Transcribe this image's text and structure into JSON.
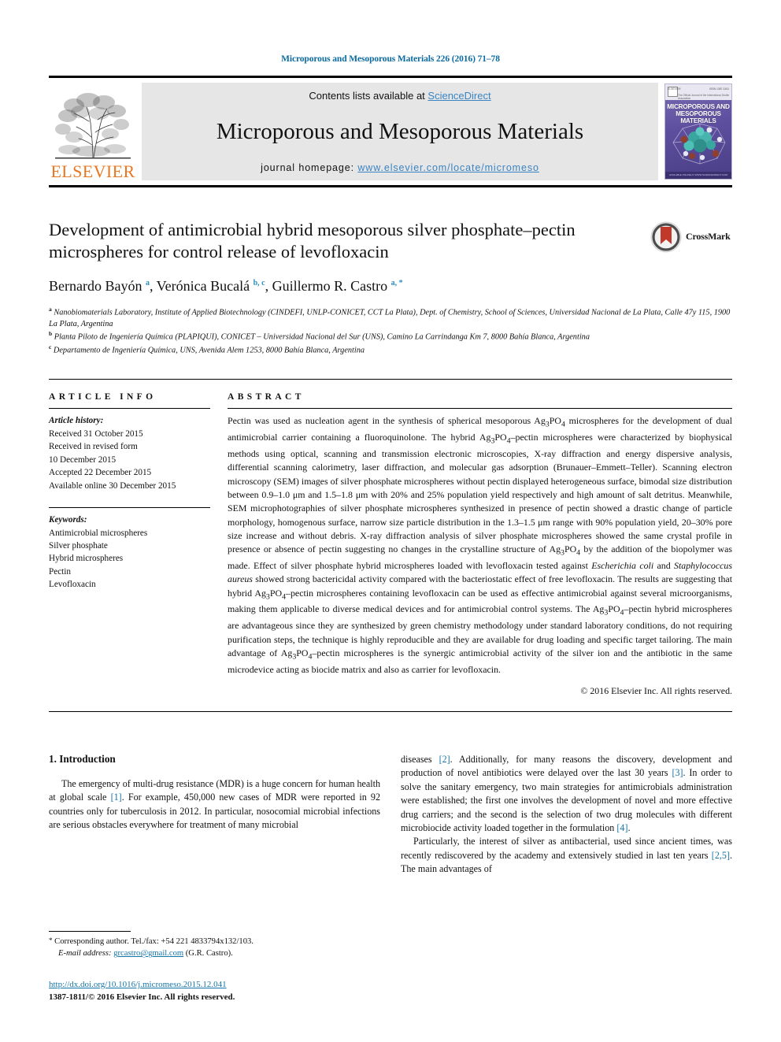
{
  "running_head": "Microporous and Mesoporous Materials 226 (2016) 71–78",
  "masthead": {
    "publisher_name": "ELSEVIER",
    "contents_prefix": "Contents lists available at ",
    "contents_link": "ScienceDirect",
    "journal_name": "Microporous and Mesoporous Materials",
    "homepage_prefix": "journal homepage: ",
    "homepage_url": "www.elsevier.com/locate/micromeso",
    "cover_title": "MICROPOROUS AND MESOPOROUS MATERIALS",
    "cover_top_left": "ELSEVIER",
    "cover_top_right": "ISSN 1387-1811",
    "cover_subtitle": "The Official Journal of the International Zeolite Association",
    "cover_bottom": "AVAILABLE ONLINE AT WWW.SCIENCEDIRECT.COM"
  },
  "article": {
    "title": "Development of antimicrobial hybrid mesoporous silver phosphate–pectin microspheres for control release of levofloxacin",
    "crossmark_label": "CrossMark",
    "authors_html": "Bernardo Bayón <sup>a</sup>, Verónica Bucalá <sup>b, c</sup>, Guillermo R. Castro <sup>a, *</sup>",
    "affiliations": [
      "Nanobiomaterials Laboratory, Institute of Applied Biotechnology (CINDEFI, UNLP-CONICET, CCT La Plata), Dept. of Chemistry, School of Sciences, Universidad Nacional de La Plata, Calle 47y 115, 1900 La Plata, Argentina",
      "Planta Piloto de Ingeniería Química (PLAPIQUI), CONICET – Universidad Nacional del Sur (UNS), Camino La Carrindanga Km 7, 8000 Bahía Blanca, Argentina",
      "Departamento de Ingeniería Química, UNS, Avenida Alem 1253, 8000 Bahía Blanca, Argentina"
    ],
    "affiliation_marks": [
      "a",
      "b",
      "c"
    ]
  },
  "article_info": {
    "heading": "ARTICLE INFO",
    "history_label": "Article history:",
    "history": [
      "Received 31 October 2015",
      "Received in revised form",
      "10 December 2015",
      "Accepted 22 December 2015",
      "Available online 30 December 2015"
    ],
    "keywords_label": "Keywords:",
    "keywords": [
      "Antimicrobial microspheres",
      "Silver phosphate",
      "Hybrid microspheres",
      "Pectin",
      "Levofloxacin"
    ]
  },
  "abstract": {
    "heading": "ABSTRACT",
    "text_html": "Pectin was used as nucleation agent in the synthesis of spherical mesoporous Ag<sub>3</sub>PO<sub>4</sub> microspheres for the development of dual antimicrobial carrier containing a fluoroquinolone. The hybrid Ag<sub>3</sub>PO<sub>4</sub>–pectin microspheres were characterized by biophysical methods using optical, scanning and transmission electronic microscopies, X-ray diffraction and energy dispersive analysis, differential scanning calorimetry, laser diffraction, and molecular gas adsorption (Brunauer–Emmett–Teller). Scanning electron microscopy (SEM) images of silver phosphate microspheres without pectin displayed heterogeneous surface, bimodal size distribution between 0.9–1.0 μm and 1.5–1.8 μm with 20% and 25% population yield respectively and high amount of salt detritus. Meanwhile, SEM microphotographies of silver phosphate microspheres synthesized in presence of pectin showed a drastic change of particle morphology, homogenous surface, narrow size particle distribution in the 1.3–1.5 μm range with 90% population yield, 20–30% pore size increase and without debris. X-ray diffraction analysis of silver phosphate microspheres showed the same crystal profile in presence or absence of pectin suggesting no changes in the crystalline structure of Ag<sub>3</sub>PO<sub>4</sub> by the addition of the biopolymer was made. Effect of silver phosphate hybrid microspheres loaded with levofloxacin tested against <i>Escherichia coli</i> and <i>Staphylococcus aureus</i> showed strong bactericidal activity compared with the bacteriostatic effect of free levofloxacin. The results are suggesting that hybrid Ag<sub>3</sub>PO<sub>4</sub>–pectin microspheres containing levofloxacin can be used as effective antimicrobial against several microorganisms, making them applicable to diverse medical devices and for antimicrobial control systems. The Ag<sub>3</sub>PO<sub>4</sub>–pectin hybrid microspheres are advantageous since they are synthesized by green chemistry methodology under standard laboratory conditions, do not requiring purification steps, the technique is highly reproducible and they are available for drug loading and specific target tailoring. The main advantage of Ag<sub>3</sub>PO<sub>4</sub>–pectin microspheres is the synergic antimicrobial activity of the silver ion and the antibiotic in the same microdevice acting as biocide matrix and also as carrier for levofloxacin.",
    "copyright": "© 2016 Elsevier Inc. All rights reserved."
  },
  "introduction": {
    "heading": "1. Introduction",
    "col_left_html": "The emergency of multi-drug resistance (MDR) is a huge concern for human health at global scale <span class=\"ref\">[1]</span>. For example, 450,000 new cases of MDR were reported in 92 countries only for tuberculosis in 2012. In particular, nosocomial microbial infections are serious obstacles everywhere for treatment of many microbial",
    "col_right_p1_html": "diseases <span class=\"ref\">[2]</span>. Additionally, for many reasons the discovery, development and production of novel antibiotics were delayed over the last 30 years <span class=\"ref\">[3]</span>. In order to solve the sanitary emergency, two main strategies for antimicrobials administration were established; the first one involves the development of novel and more effective drug carriers; and the second is the selection of two drug molecules with different microbiocide activity loaded together in the formulation <span class=\"ref\">[4]</span>.",
    "col_right_p2_html": "Particularly, the interest of silver as antibacterial, used since ancient times, was recently rediscovered by the academy and extensively studied in last ten years <span class=\"ref\">[2,5]</span>. The main advantages of"
  },
  "footnote": {
    "corresponding_html": "<span class=\"star\">*</span> Corresponding author. Tel./fax: +54 221 4833794x132/103.",
    "email_label": "E-mail address:",
    "email": "grcastro@gmail.com",
    "email_suffix": "(G.R. Castro)."
  },
  "footer": {
    "doi": "http://dx.doi.org/10.1016/j.micromeso.2015.12.041",
    "issn_line": "1387-1811/© 2016 Elsevier Inc. All rights reserved."
  }
}
